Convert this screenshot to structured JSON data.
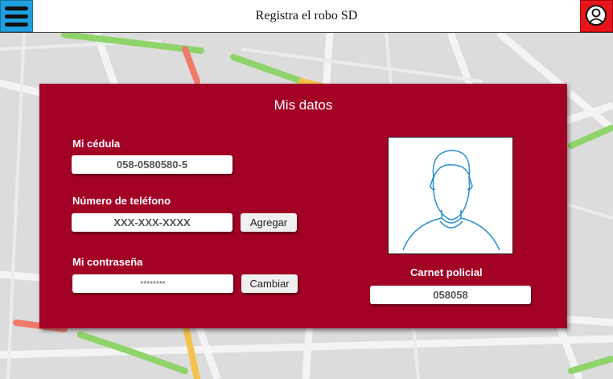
{
  "header": {
    "title": "Registra el robo SD",
    "menu_icon": "hamburger-menu-icon",
    "profile_icon": "user-profile-icon",
    "menu_color": "#1ea0e0",
    "profile_color": "#e8141c"
  },
  "panel": {
    "title": "Mis datos",
    "background": "#a30026",
    "cedula": {
      "label": "Mi cédula",
      "value": "058-0580580-5"
    },
    "telefono": {
      "label": "Número de teléfono",
      "placeholder": "XXX-XXX-XXXX",
      "button": "Agregar"
    },
    "contrasena": {
      "label": "Mi contraseña",
      "value": "********",
      "button": "Cambiar"
    },
    "carnet": {
      "label": "Carnet policial",
      "value": "058058"
    },
    "photo_icon": "user-silhouette-icon"
  }
}
